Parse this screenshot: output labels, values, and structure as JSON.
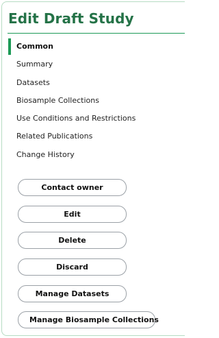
{
  "panel": {
    "title": "Edit Draft Study"
  },
  "nav": {
    "items": [
      {
        "label": "Common",
        "active": true
      },
      {
        "label": "Summary",
        "active": false
      },
      {
        "label": "Datasets",
        "active": false
      },
      {
        "label": "Biosample Collections",
        "active": false
      },
      {
        "label": "Use Conditions and Restrictions",
        "active": false
      },
      {
        "label": "Related Publications",
        "active": false
      },
      {
        "label": "Change History",
        "active": false
      }
    ]
  },
  "actions": {
    "contact_owner": "Contact owner",
    "edit": "Edit",
    "delete": "Delete",
    "discard": "Discard",
    "manage_datasets": "Manage Datasets",
    "manage_biosample_collections": "Manage Biosample Collections"
  },
  "colors": {
    "accent": "#1c9a56",
    "title": "#247247",
    "panel_border": "#b5dbc2"
  }
}
